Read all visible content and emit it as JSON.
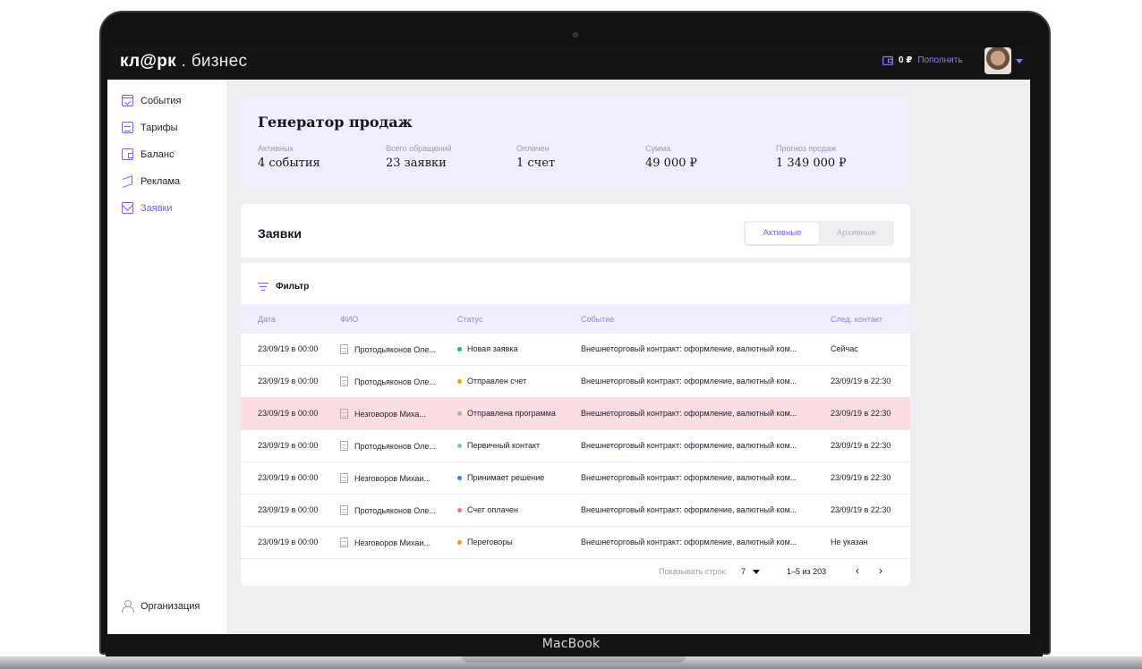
{
  "device": {
    "label": "MacBook"
  },
  "header": {
    "logo_main": "кл@рк",
    "logo_sub": ". бизнес",
    "balance_amount": "0 ₽",
    "topup_label": "Пополнить"
  },
  "sidebar": {
    "items": [
      {
        "label": "События",
        "icon": "calendar-check-icon"
      },
      {
        "label": "Тарифы",
        "icon": "document-icon"
      },
      {
        "label": "Баланс",
        "icon": "wallet-icon"
      },
      {
        "label": "Реклама",
        "icon": "megaphone-icon"
      },
      {
        "label": "Заявки",
        "icon": "envelope-icon",
        "active": true
      }
    ],
    "bottom_item": {
      "label": "Организация",
      "icon": "user-icon"
    }
  },
  "sales": {
    "title": "Генератор продаж",
    "stats": [
      {
        "label": "Активных",
        "value": "4 события"
      },
      {
        "label": "Всего обращений",
        "value": "23 заявки"
      },
      {
        "label": "Оплачен",
        "value": "1 счет"
      },
      {
        "label": "Сумма",
        "value": "49 000 ₽"
      },
      {
        "label": "Прогноз продаж",
        "value": "1 349 000 ₽"
      }
    ]
  },
  "orders": {
    "title": "Заявки",
    "segments": {
      "active": "Активные",
      "archived": "Архивные"
    },
    "filter_label": "Фильтр",
    "columns": [
      "Дата",
      "ФИО",
      "Статус",
      "Событие",
      "След. контакт"
    ],
    "rows": [
      {
        "date": "23/09/19 в 00:00",
        "fio": "Протодьяконов Оле...",
        "status": "Новая заявка",
        "status_color": "#22b573",
        "event": "Внешнеторговый контракт: оформление, валютный ком...",
        "next": "Сейчас",
        "highlight": false
      },
      {
        "date": "23/09/19 в 00:00",
        "fio": "Протодьяконов Оле...",
        "status": "Отправлен счет",
        "status_color": "#d4b106",
        "event": "Внешнеторговый контракт: оформление, валютный ком...",
        "next": "23/09/19 в 22:30",
        "highlight": false
      },
      {
        "date": "23/09/19 в 00:00",
        "fio": "Незговоров Миха...",
        "status": "Отправлена программа",
        "status_color": "#a9b4b0",
        "event": "Внешнеторговый контракт: оформление, валютный ком...",
        "next": "23/09/19 в 22:30",
        "highlight": true
      },
      {
        "date": "23/09/19 в 00:00",
        "fio": "Протодьяконов Оле...",
        "status": "Первичный контакт",
        "status_color": "#7cc4a8",
        "event": "Внешнеторговый контракт: оформление, валютный ком...",
        "next": "23/09/19 в 22:30",
        "highlight": false
      },
      {
        "date": "23/09/19 в 00:00",
        "fio": "Незговоров Михаи...",
        "status": "Принимает решение",
        "status_color": "#3d7ff0",
        "event": "Внешнеторговый контракт: оформление, валютный ком...",
        "next": "23/09/19 в 22:30",
        "highlight": false
      },
      {
        "date": "23/09/19 в 00:00",
        "fio": "Протодьяконов Оле...",
        "status": "Счет оплачен",
        "status_color": "#f07a86",
        "event": "Внешнеторговый контракт: оформление, валютный ком...",
        "next": "23/09/19 в 22:30",
        "highlight": false
      },
      {
        "date": "23/09/19 в 00:00",
        "fio": "Незговоров Михаи...",
        "status": "Переговоры",
        "status_color": "#f0961e",
        "event": "Внешнеторговый контракт: оформление, валютный ком...",
        "next": "Не указан",
        "highlight": false
      }
    ],
    "pager": {
      "rows_label": "Показывать строк:",
      "rows_value": "7",
      "range": "1–5 из 203",
      "prev": "‹",
      "next": "›"
    }
  },
  "colors": {
    "accent": "#6f62ec",
    "header_bg": "#141414",
    "highlight_row": "#fbdde3"
  }
}
